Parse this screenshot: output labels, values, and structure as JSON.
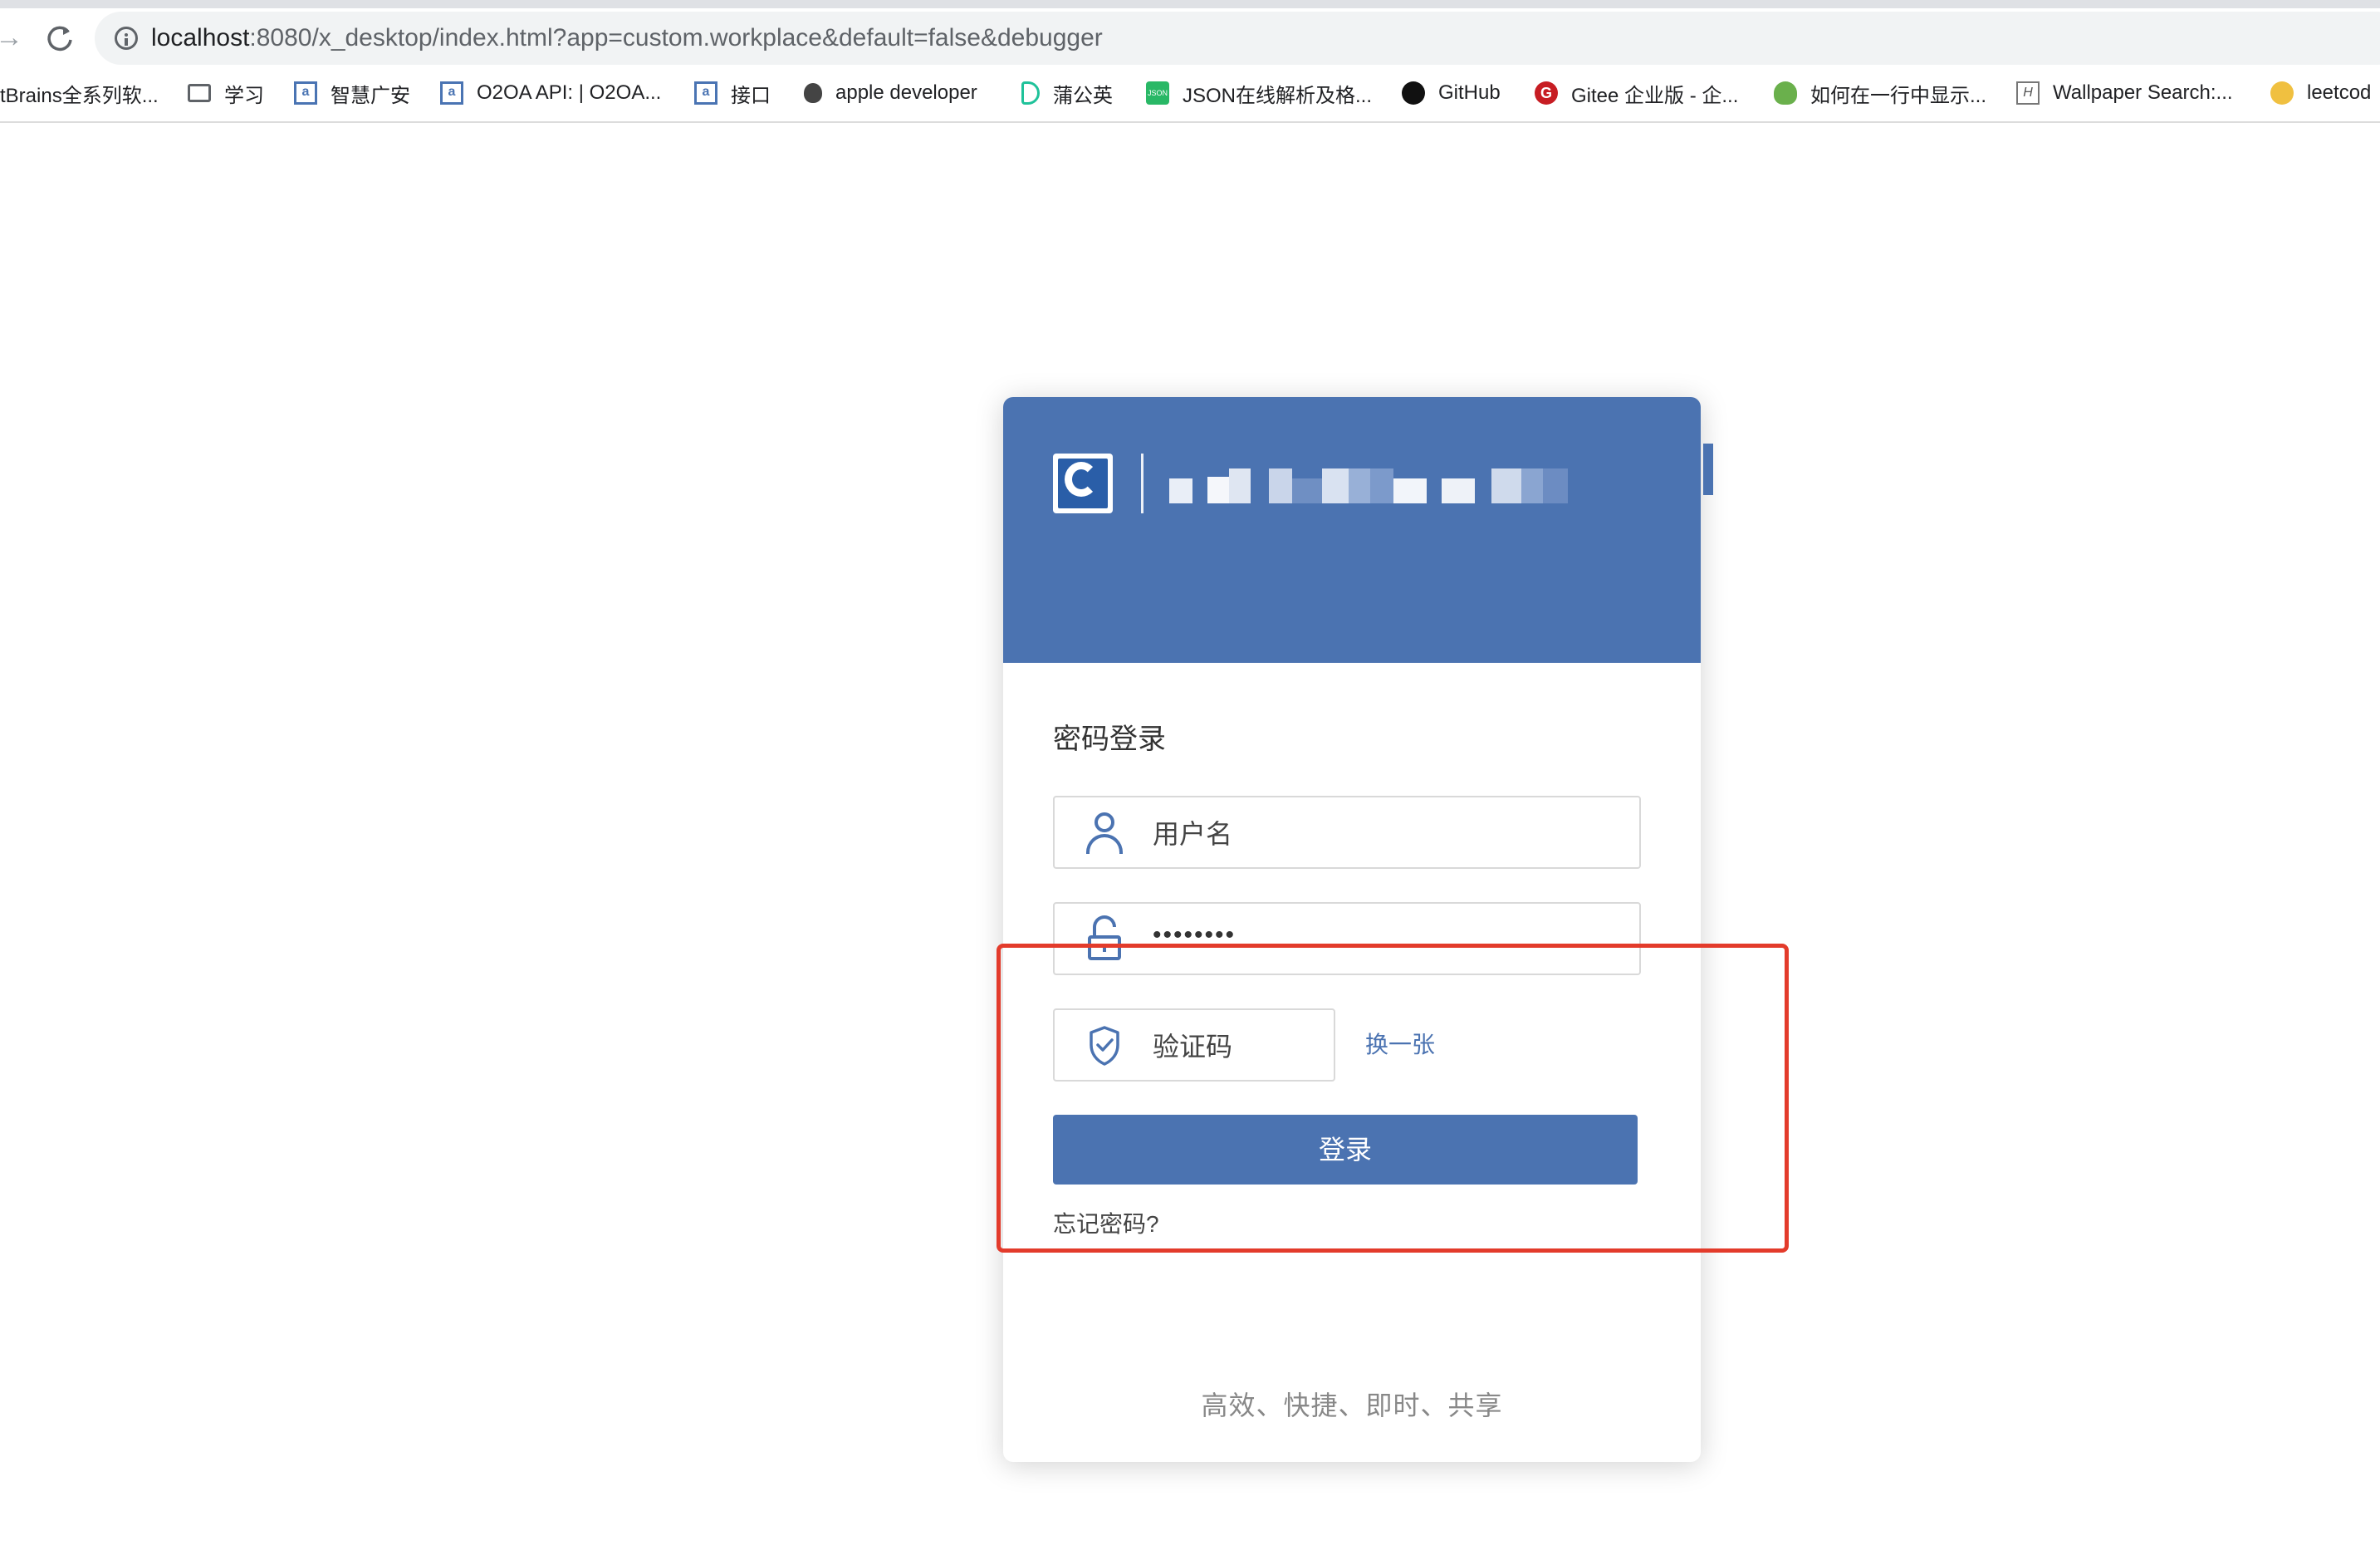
{
  "browser": {
    "url_host": "localhost",
    "url_rest": ":8080/x_desktop/index.html?app=custom.workplace&default=false&debugger",
    "bookmarks": [
      {
        "label": "tBrains全系列软...",
        "icon": "jetbrains-icon"
      },
      {
        "label": "学习",
        "icon": "folder-icon"
      },
      {
        "label": "智慧广安",
        "icon": "o2oa-icon"
      },
      {
        "label": "O2OA API: | O2OA...",
        "icon": "o2oa-icon"
      },
      {
        "label": "接口",
        "icon": "o2oa-icon"
      },
      {
        "label": "apple developer",
        "icon": "apple-icon"
      },
      {
        "label": "蒲公英",
        "icon": "pgyer-icon"
      },
      {
        "label": "JSON在线解析及格...",
        "icon": "json-icon"
      },
      {
        "label": "GitHub",
        "icon": "github-icon"
      },
      {
        "label": "Gitee 企业版 - 企...",
        "icon": "gitee-icon"
      },
      {
        "label": "如何在一行中显示...",
        "icon": "green-leaf-icon"
      },
      {
        "label": "Wallpaper Search:...",
        "icon": "wallpaper-icon"
      },
      {
        "label": "leetcod",
        "icon": "leetcode-icon"
      }
    ]
  },
  "login": {
    "title": "密码登录",
    "username_placeholder": "用户名",
    "password_value": "••••••••",
    "captcha_placeholder": "验证码",
    "refresh_captcha": "换一张",
    "submit": "登录",
    "forgot_password": "忘记密码?",
    "slogan": "高效、快捷、即时、共享"
  },
  "colors": {
    "brand": "#4b73b1",
    "annotation": "#e33b2b"
  }
}
